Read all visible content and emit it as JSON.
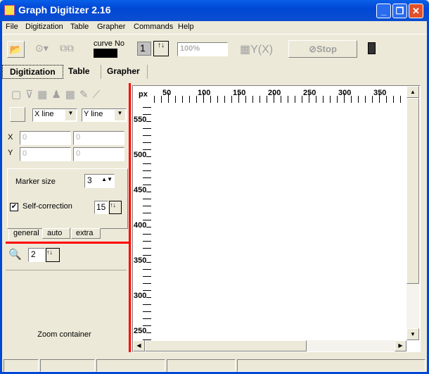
{
  "window": {
    "title": "Graph Digitizer 2.16",
    "minimize": "_",
    "restore": "❐",
    "close": "✕"
  },
  "menu": [
    "File",
    "Digitization",
    "Table",
    "Grapher",
    "Commands",
    "Help"
  ],
  "toolbar": {
    "curve_label": "curve No",
    "curve_value": "1",
    "zoom_value": "100%",
    "yx_label": "Y(X)",
    "stop_label": "Stop"
  },
  "tabs": [
    "Digitization",
    "Table",
    "Grapher"
  ],
  "panel": {
    "x_line": "X line",
    "y_line": "Y line",
    "x_label": "X",
    "y_label": "Y",
    "x1": "0",
    "x2": "0",
    "y1": "0",
    "y2": "0",
    "marker_size_label": "Marker size",
    "marker_size": "3",
    "self_correction_label": "Self-correction",
    "self_correction_value": "15",
    "self_correction_checked": true,
    "subtabs": [
      "general",
      "auto",
      "extra"
    ],
    "zoom_value": "2",
    "zoom_container": "Zoom container"
  },
  "ruler": {
    "unit": "px",
    "x_labels": [
      "50",
      "100",
      "150",
      "200",
      "250",
      "300",
      "350"
    ],
    "y_labels": [
      "550",
      "500",
      "450",
      "400",
      "350",
      "300",
      "250"
    ]
  }
}
